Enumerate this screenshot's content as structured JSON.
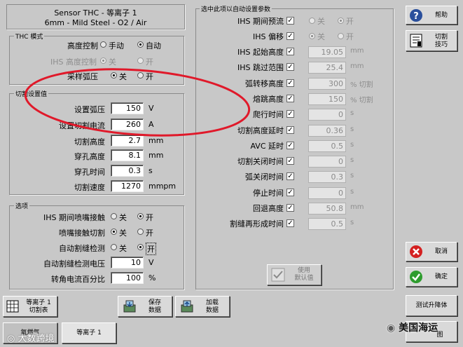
{
  "header": {
    "line1": "Sensor THC - 等离子 1",
    "line2": "6mm - Mild Steel - O2 / Air"
  },
  "thc_mode": {
    "title": "THC 模式",
    "height_control_label": "高度控制",
    "manual_label": "手动",
    "auto_label": "自动",
    "ihs_label": "IHS 高度控制",
    "ihs_off": "关",
    "ihs_on": "开",
    "sample_label": "采样弧压",
    "sample_off": "关",
    "sample_on": "开"
  },
  "cut_settings": {
    "title": "切割设置值",
    "rows": [
      {
        "label": "设置弧压",
        "value": "150",
        "unit": "V"
      },
      {
        "label": "设置切割电流",
        "value": "260",
        "unit": "A"
      },
      {
        "label": "切割高度",
        "value": "2.7",
        "unit": "mm"
      },
      {
        "label": "穿孔高度",
        "value": "8.1",
        "unit": "mm"
      },
      {
        "label": "穿孔时间",
        "value": "0.3",
        "unit": "s"
      },
      {
        "label": "切割速度",
        "value": "1270",
        "unit": "mmpm"
      }
    ]
  },
  "options": {
    "title": "选项",
    "radio_rows": [
      {
        "label": "IHS 期间喷嘴接触",
        "off": "关",
        "on": "开"
      },
      {
        "label": "喷嘴接触切割",
        "off": "关",
        "on": "开"
      },
      {
        "label": "自动割缝检测",
        "off": "关",
        "on": "开"
      }
    ],
    "voltage_label": "自动割缝检测电压",
    "voltage_value": "10",
    "voltage_unit": "V",
    "corner_label": "转角电流百分比",
    "corner_value": "100",
    "corner_unit": "%"
  },
  "auto_params": {
    "title": "选中此项以自动设置参数",
    "ihs_prefire_label": "IHS 期间预流",
    "ihs_prefire_off": "关",
    "ihs_prefire_on": "开",
    "ihs_offset_label": "IHS 偏移",
    "ihs_offset_off": "关",
    "ihs_offset_on": "开",
    "rows": [
      {
        "label": "IHS 起始高度",
        "value": "19.05",
        "unit": "mm"
      },
      {
        "label": "IHS 跳过范围",
        "value": "25.4",
        "unit": "mm"
      },
      {
        "label": "弧转移高度",
        "value": "300",
        "unit": "% 切割"
      },
      {
        "label": "熔跳高度",
        "value": "150",
        "unit": "% 切割"
      },
      {
        "label": "爬行时间",
        "value": "0",
        "unit": "s"
      },
      {
        "label": "切割高度延时",
        "value": "0.36",
        "unit": "s"
      },
      {
        "label": "AVC 延时",
        "value": "0.5",
        "unit": "s"
      },
      {
        "label": "切割关闭时间",
        "value": "0",
        "unit": "s"
      },
      {
        "label": "弧关闭时间",
        "value": "0.3",
        "unit": "s"
      },
      {
        "label": "停止时间",
        "value": "0",
        "unit": "s"
      },
      {
        "label": "回退高度",
        "value": "50.8",
        "unit": "mm"
      },
      {
        "label": "割缝再形成时间",
        "value": "0.5",
        "unit": "s"
      }
    ],
    "use_defaults_label1": "使用",
    "use_defaults_label2": "默认值"
  },
  "right_buttons": {
    "help": "帮助",
    "cut_tips1": "切割",
    "cut_tips2": "技巧",
    "cancel": "取消",
    "ok": "确定",
    "test_lift": "测试升降体",
    "partial": "图"
  },
  "bottom_buttons": {
    "plasma_cut_table1": "等离子 1",
    "plasma_cut_table2": "切割表",
    "save1": "保存",
    "save2": "数据",
    "load1": "加载",
    "load2": "数据",
    "tab_gas": "氧燃气",
    "tab_plasma": "等离子 1"
  },
  "watermark": {
    "left": "大数跨境",
    "right": "美国海运"
  },
  "colors": {
    "background": "#c8c8c8",
    "annotation_red": "#e0192a",
    "help_blue": "#2a4f9c",
    "cancel_red": "#d42020",
    "ok_green": "#2e9c2e"
  }
}
